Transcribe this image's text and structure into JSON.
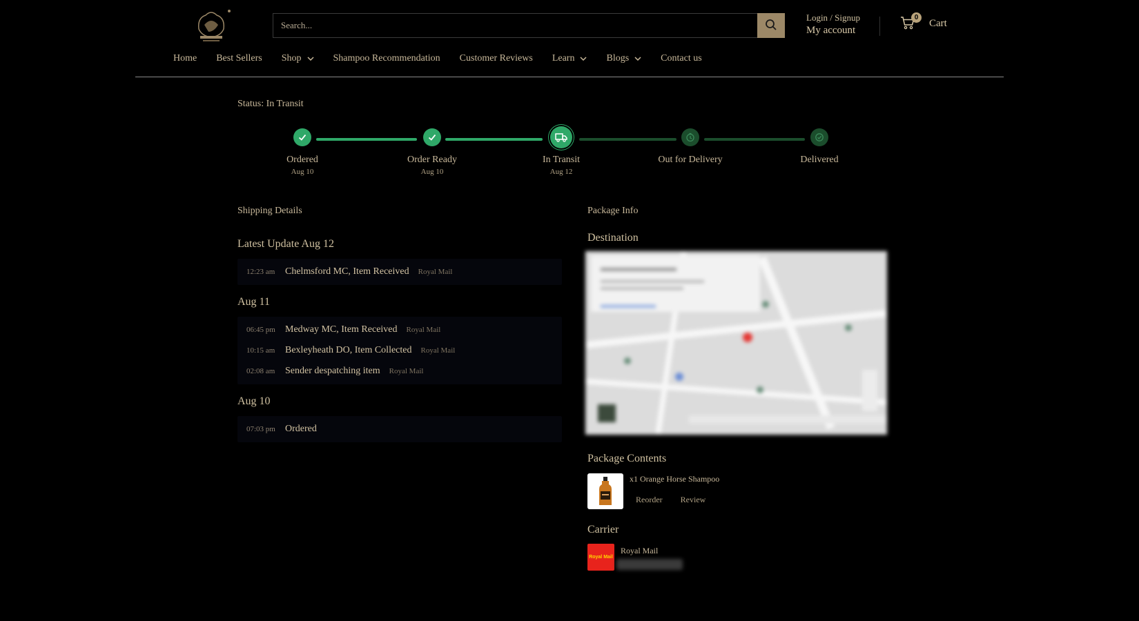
{
  "header": {
    "search": {
      "placeholder": "Search..."
    },
    "account": {
      "login_label": "Login / Signup",
      "my_account_label": "My account"
    },
    "cart": {
      "count": "0",
      "label": "Cart"
    },
    "nav": [
      {
        "label": "Home",
        "has_dropdown": false
      },
      {
        "label": "Best Sellers",
        "has_dropdown": false
      },
      {
        "label": "Shop",
        "has_dropdown": true
      },
      {
        "label": "Shampoo Recommendation",
        "has_dropdown": false
      },
      {
        "label": "Customer Reviews",
        "has_dropdown": false
      },
      {
        "label": "Learn",
        "has_dropdown": true
      },
      {
        "label": "Blogs",
        "has_dropdown": true
      },
      {
        "label": "Contact us",
        "has_dropdown": false
      }
    ]
  },
  "status": {
    "text": "Status: In Transit"
  },
  "tracker": {
    "steps": [
      {
        "label": "Ordered",
        "date": "Aug 10",
        "state": "done",
        "icon": "check-icon"
      },
      {
        "label": "Order Ready",
        "date": "Aug 10",
        "state": "done",
        "icon": "check-icon"
      },
      {
        "label": "In Transit",
        "date": "Aug 12",
        "state": "active",
        "icon": "truck-icon"
      },
      {
        "label": "Out for Delivery",
        "date": "",
        "state": "todo",
        "icon": "clock-icon"
      },
      {
        "label": "Delivered",
        "date": "",
        "state": "todo",
        "icon": "check-circle-icon"
      }
    ]
  },
  "shipping": {
    "title": "Shipping Details",
    "groups": [
      {
        "title": "Latest Update Aug 12",
        "events": [
          {
            "time": "12:23 am",
            "desc": "Chelmsford MC, Item Received",
            "carrier": "Royal Mail"
          }
        ]
      },
      {
        "title": "Aug 11",
        "events": [
          {
            "time": "06:45 pm",
            "desc": "Medway MC, Item Received",
            "carrier": "Royal Mail"
          },
          {
            "time": "10:15 am",
            "desc": "Bexleyheath DO, Item Collected",
            "carrier": "Royal Mail"
          },
          {
            "time": "02:08 am",
            "desc": "Sender despatching item",
            "carrier": "Royal Mail"
          }
        ]
      },
      {
        "title": "Aug 10",
        "events": [
          {
            "time": "07:03 pm",
            "desc": "Ordered",
            "carrier": ""
          }
        ]
      }
    ]
  },
  "package": {
    "title": "Package Info",
    "destination_title": "Destination",
    "contents_title": "Package Contents",
    "item": {
      "name": "x1 Orange Horse Shampoo",
      "reorder_label": "Reorder",
      "review_label": "Review"
    },
    "carrier_title": "Carrier",
    "carrier": {
      "name": "Royal Mail",
      "logo_text": "Royal Mail"
    }
  },
  "colors": {
    "accent_gold": "#9c8867",
    "text_gold": "#d9c9a8",
    "progress_done": "#2fa868",
    "progress_todo": "#1b4d2c",
    "royal_mail_red": "#e8231c"
  }
}
